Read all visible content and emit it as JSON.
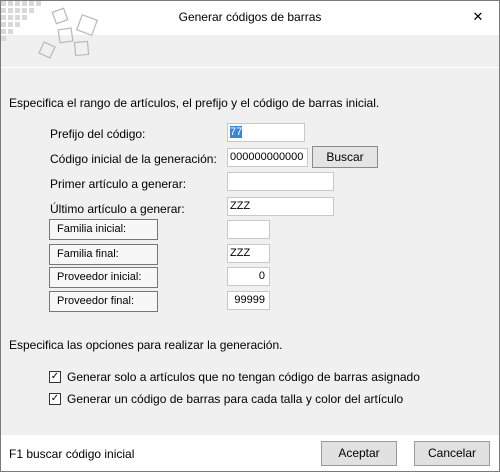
{
  "window": {
    "title": "Generar códigos de barras",
    "close_glyph": "✕"
  },
  "intro_text": "Especifica el rango de artículos, el prefijo y el código de barras inicial.",
  "fields": {
    "prefijo": {
      "label": "Prefijo del código:",
      "value": "77"
    },
    "codigo_inicial": {
      "label": "Código inicial de la generación:",
      "value": "000000000000",
      "button": "Buscar"
    },
    "primer_articulo": {
      "label": "Primer artículo a generar:",
      "value": ""
    },
    "ultimo_articulo": {
      "label": "Último artículo a generar:",
      "value": "ZZZ"
    },
    "familia_inicial": {
      "label": "Familia inicial:",
      "value": ""
    },
    "familia_final": {
      "label": "Familia final:",
      "value": "ZZZ"
    },
    "proveedor_inicial": {
      "label": "Proveedor inicial:",
      "value": "0"
    },
    "proveedor_final": {
      "label": "Proveedor final:",
      "value": "99999"
    }
  },
  "options_text": "Especifica las opciones para realizar la generación.",
  "options": [
    {
      "label": "Generar solo a artículos que no tengan código de barras asignado",
      "checked": true
    },
    {
      "label": "Generar un código de barras para cada talla y color del artículo",
      "checked": true
    }
  ],
  "footer": {
    "hint": "F1 buscar código inicial",
    "accept": "Aceptar",
    "cancel": "Cancelar"
  },
  "check_glyph": "✓"
}
